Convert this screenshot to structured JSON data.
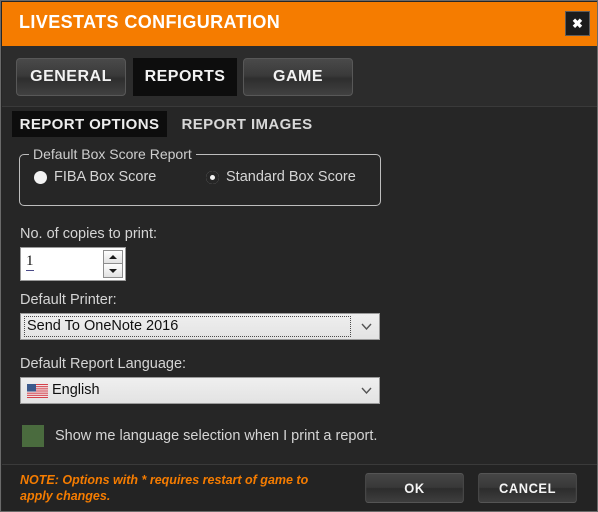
{
  "window": {
    "title": "LIVESTATS CONFIGURATION",
    "close_icon": "close-icon",
    "close_glyph": "✖",
    "accent_color": "#f57c00",
    "background_color": "#262626"
  },
  "tabs": [
    {
      "id": "general",
      "label": "GENERAL",
      "active": false
    },
    {
      "id": "reports",
      "label": "REPORTS",
      "active": true
    },
    {
      "id": "game",
      "label": "GAME",
      "active": false
    }
  ],
  "subtabs": [
    {
      "id": "report-options",
      "label": "REPORT OPTIONS",
      "active": true
    },
    {
      "id": "report-images",
      "label": "REPORT IMAGES",
      "active": false
    }
  ],
  "groupbox": {
    "legend": "Default Box Score Report",
    "options": [
      {
        "id": "fiba",
        "label": "FIBA Box Score",
        "state": "filled"
      },
      {
        "id": "standard",
        "label": "Standard Box Score",
        "state": "ring"
      }
    ]
  },
  "copies": {
    "label": "No. of copies to print:",
    "value": "1",
    "increment_icon": "triangle-up-icon",
    "decrement_icon": "triangle-down-icon"
  },
  "printer": {
    "label": "Default Printer:",
    "value": "Send To OneNote 2016",
    "chevron_icon": "chevron-down-icon"
  },
  "language": {
    "label": "Default Report Language:",
    "value": "English",
    "flag_icon": "us-flag-icon",
    "chevron_icon": "chevron-down-icon"
  },
  "language_prompt": {
    "label": "Show me language selection when I print a report.",
    "checked": true,
    "checkbox_color": "#4a6b3e"
  },
  "footer": {
    "note": "NOTE: Options with * requires restart of game to apply changes.",
    "note_color": "#f57c00",
    "ok_label": "OK",
    "cancel_label": "CANCEL"
  }
}
